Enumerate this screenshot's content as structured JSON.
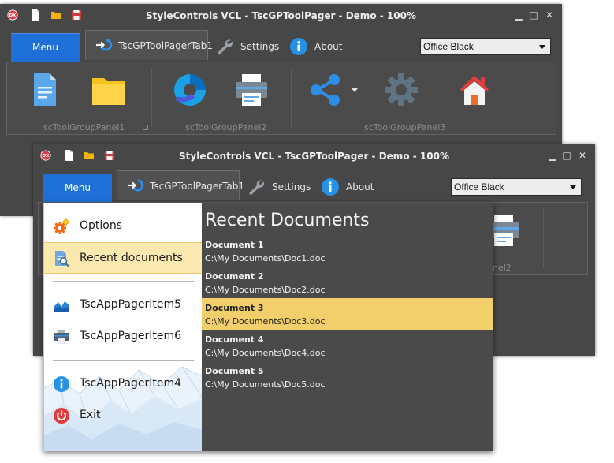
{
  "window_back": {
    "title": "StyleControls VCL - TscGPToolPager - Demo - 100%",
    "menu_label": "Menu",
    "active_tab": "TscGPToolPagerTab1",
    "tab_settings": "Settings",
    "tab_about": "About",
    "style_select": "Office Black",
    "group_labels": [
      "scToolGroupPanel1",
      "scToolGroupPanel2",
      "scToolGroupPanel3"
    ],
    "toolbar_icons": [
      "document-icon",
      "folder-icon",
      "chart-icon",
      "printer-icon",
      "share-icon",
      "gear-icon",
      "home-icon"
    ]
  },
  "window_front": {
    "title": "StyleControls VCL - TscGPToolPager - Demo - 100%",
    "menu_label": "Menu",
    "active_tab": "TscGPToolPagerTab1",
    "tab_settings": "Settings",
    "tab_about": "About",
    "style_select": "Office Black",
    "group_label_partial": "nel2"
  },
  "pager": {
    "items": [
      {
        "label": "Options",
        "icon": "options-gears-icon"
      },
      {
        "label": "Recent documents",
        "icon": "recent-documents-icon"
      },
      {
        "label": "TscAppPagerItem5",
        "icon": "area-chart-icon"
      },
      {
        "label": "TscAppPagerItem6",
        "icon": "printer-icon"
      },
      {
        "label": "TscAppPagerItem4",
        "icon": "info-icon"
      },
      {
        "label": "Exit",
        "icon": "power-icon"
      }
    ],
    "selected_item": "Recent documents",
    "recent_title": "Recent Documents",
    "documents": [
      {
        "name": "Document 1",
        "path": "C:\\My Documents\\Doc1.doc"
      },
      {
        "name": "Document 2",
        "path": "C:\\My Documents\\Doc2.doc"
      },
      {
        "name": "Document 3",
        "path": "C:\\My Documents\\Doc3.doc"
      },
      {
        "name": "Document 4",
        "path": "C:\\My Documents\\Doc4.doc"
      },
      {
        "name": "Document 5",
        "path": "C:\\My Documents\\Doc5.doc"
      }
    ],
    "selected_document": "Document 3"
  },
  "colors": {
    "window_bg": "#474747",
    "menu_accent": "#1e6fd8",
    "selection_pale": "#fce9b0",
    "selection_gold": "#f2cf6a"
  }
}
